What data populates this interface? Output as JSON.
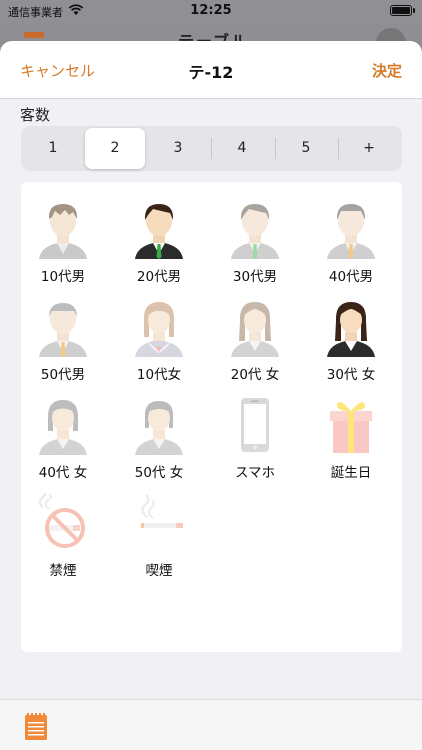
{
  "status_bar": {
    "carrier": "通信事業者",
    "time": "12:25"
  },
  "background_page": {
    "title": "テーブル"
  },
  "nav": {
    "cancel": "キャンセル",
    "title": "テ-12",
    "done": "決定"
  },
  "guest_count": {
    "label": "客数",
    "options": [
      "1",
      "2",
      "3",
      "4",
      "5",
      "+"
    ],
    "selected": "2"
  },
  "attributes": [
    {
      "label": "10代男"
    },
    {
      "label": "20代男"
    },
    {
      "label": "30代男"
    },
    {
      "label": "40代男"
    },
    {
      "label": "50代男"
    },
    {
      "label": "10代女"
    },
    {
      "label": "20代 女"
    },
    {
      "label": "30代 女"
    },
    {
      "label": "40代 女"
    },
    {
      "label": "50代 女"
    },
    {
      "label": "スマホ"
    },
    {
      "label": "誕生日"
    },
    {
      "label": "禁煙"
    },
    {
      "label": "喫煙"
    }
  ],
  "colors": {
    "accent": "#d67a2a",
    "sheet_bg": "#f1f1f5"
  }
}
